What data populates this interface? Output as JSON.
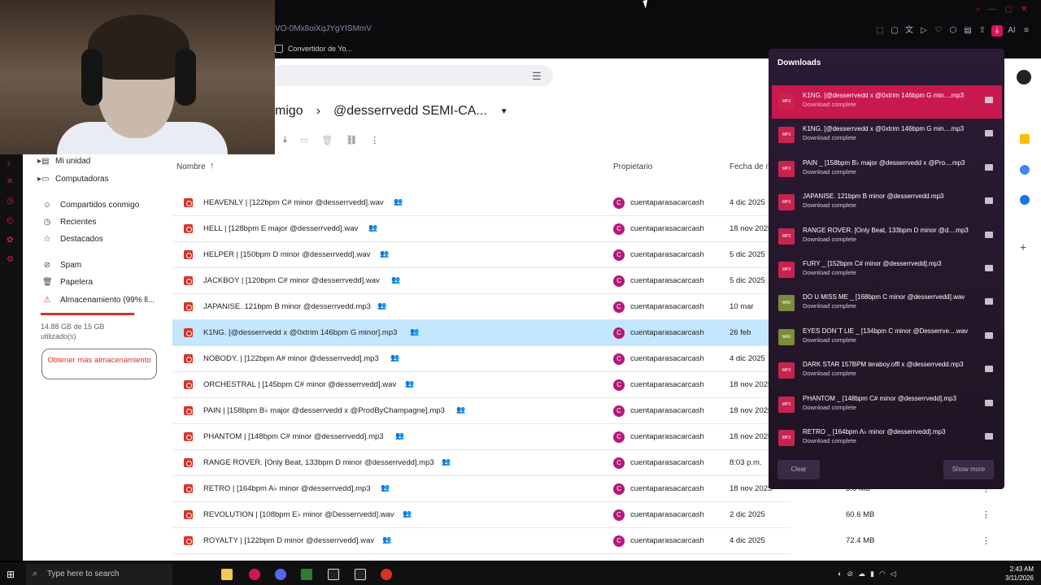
{
  "browser": {
    "url_fragment": "VO-0Mx8oiXqJYgYISMmV",
    "tab_label": "Convertidor de Yo...",
    "toolbar_ai_label": "AI"
  },
  "drive": {
    "breadcrumb_parent": "migo",
    "breadcrumb_current": "@desserrvedd SEMI-CA...",
    "sidebar": [
      {
        "icon": "drive-icon",
        "label": "Mi unidad"
      },
      {
        "icon": "computer-icon",
        "label": "Computadoras"
      },
      {
        "icon": "people-icon",
        "label": "Compartidos conmigo"
      },
      {
        "icon": "clock-icon",
        "label": "Recientes"
      },
      {
        "icon": "star-icon",
        "label": "Destacados"
      },
      {
        "icon": "spam-icon",
        "label": "Spam"
      },
      {
        "icon": "trash-icon",
        "label": "Papelera"
      },
      {
        "icon": "warning-icon",
        "label": "Almacenamiento (99% ll..."
      }
    ],
    "storage_fraction": 0.99,
    "storage_text": "14.88 GB de 15 GB utilizado(s)",
    "get_more_label": "Obtener más almacenamiento",
    "columns": {
      "name": "Nombre",
      "owner": "Propietario",
      "date": "Fecha de m"
    },
    "rows": [
      {
        "name": "HEAVENLY | [122bpm C# minor @desserrvedd].wav",
        "owner": "cuentaparasacarcash",
        "date": "4 dic 2025",
        "size": "",
        "selected": false
      },
      {
        "name": "HELL | [128bpm E major @desserrvedd].wav",
        "owner": "cuentaparasacarcash",
        "date": "18 nov 2025",
        "size": "",
        "selected": false
      },
      {
        "name": "HELPER | [150bpm D minor @desserrvedd].wav",
        "owner": "cuentaparasacarcash",
        "date": "5 dic 2025",
        "size": "",
        "selected": false
      },
      {
        "name": "JACKBOY | [120bpm C# minor @desserrvedd].wav",
        "owner": "cuentaparasacarcash",
        "date": "5 dic 2025",
        "size": "",
        "selected": false
      },
      {
        "name": "JAPANISE. 121bpm B minor @desserrvedd.mp3",
        "owner": "cuentaparasacarcash",
        "date": "10 mar",
        "size": "",
        "selected": false
      },
      {
        "name": "K1NG. [@desserrvedd x @0xtrim 146bpm G minor].mp3",
        "owner": "cuentaparasacarcash",
        "date": "26 feb",
        "size": "",
        "selected": true
      },
      {
        "name": "NOBODY. | [122bpm A# minor @desserrvedd].mp3",
        "owner": "cuentaparasacarcash",
        "date": "4 dic 2025",
        "size": "",
        "selected": false
      },
      {
        "name": "ORCHESTRAL | [145bpm C# minor @desserrvedd].wav",
        "owner": "cuentaparasacarcash",
        "date": "18 nov 2025",
        "size": "",
        "selected": false
      },
      {
        "name": "PAIN | [158bpm B♭ major @desserrvedd x @ProdByChampagne].mp3",
        "owner": "cuentaparasacarcash",
        "date": "18 nov 2025",
        "size": "",
        "selected": false
      },
      {
        "name": "PHANTOM | [148bpm C# minor @desserrvedd].mp3",
        "owner": "cuentaparasacarcash",
        "date": "18 nov 2025",
        "size": "",
        "selected": false
      },
      {
        "name": "RANGE ROVER. [Only Beat, 133bpm D minor @desserrvedd].mp3",
        "owner": "cuentaparasacarcash",
        "date": "8:03 p.m.",
        "size": "",
        "selected": false
      },
      {
        "name": "RETRO | [164bpm A♭ minor @desserrvedd].mp3",
        "owner": "cuentaparasacarcash",
        "date": "18 nov 2025",
        "size": "3.8 MB",
        "selected": false
      },
      {
        "name": "REVOLUTION | [108bpm E♭ minor @Desserrvedd].wav",
        "owner": "cuentaparasacarcash",
        "date": "2 dic 2025",
        "size": "60.6 MB",
        "selected": false
      },
      {
        "name": "ROYALTY | [122bpm D minor @desserrvedd].wav",
        "owner": "cuentaparasacarcash",
        "date": "4 dic 2025",
        "size": "72.4 MB",
        "selected": false
      }
    ]
  },
  "downloads": {
    "title": "Downloads",
    "items": [
      {
        "name": "K1NG. [@desserrvedd x @0xtrim 146bpm G min....mp3",
        "status": "Download complete",
        "type": "MP3",
        "active": true
      },
      {
        "name": "K1NG. [@desserrvedd x @0xtrim 146bpm G min....mp3",
        "status": "Download complete",
        "type": "MP3",
        "active": false
      },
      {
        "name": "PAIN _ [158bpm B♭ major @desserrvedd x @Pro....mp3",
        "status": "Download complete",
        "type": "MP3",
        "active": false
      },
      {
        "name": "JAPANISE. 121bpm B minor @desserrvedd.mp3",
        "status": "Download complete",
        "type": "MP3",
        "active": false
      },
      {
        "name": "RANGE ROVER. [Only Beat, 133bpm D minor @d....mp3",
        "status": "Download complete",
        "type": "MP3",
        "active": false
      },
      {
        "name": "FURY _ [152bpm C# minor @desserrvedd].mp3",
        "status": "Download complete",
        "type": "MP3",
        "active": false
      },
      {
        "name": "DO U MISS ME _ [168bpm C minor @desserrvedd].wav",
        "status": "Download complete",
        "type": "WAV",
        "active": false
      },
      {
        "name": "EYES DON´T LIE _ [134bpm C minor @Desserrve....wav",
        "status": "Download complete",
        "type": "WAV",
        "active": false
      },
      {
        "name": "DARK STAR 157BPM teraboy.offl x @desserrvedd.mp3",
        "status": "Download complete",
        "type": "MP3",
        "active": false
      },
      {
        "name": "PHANTOM _ [148bpm C# minor @desserrvedd].mp3",
        "status": "Download complete",
        "type": "MP3",
        "active": false
      },
      {
        "name": "RETRO _ [164bpm A♭ minor @desserrvedd].mp3",
        "status": "Download complete",
        "type": "MP3",
        "active": false
      }
    ],
    "clear_label": "Clear",
    "show_more_label": "Show more"
  },
  "taskbar": {
    "search_placeholder": "Type here to search",
    "time": "2:43 AM",
    "date": "3/11/2026"
  },
  "colors": {
    "accent_red": "#d93025",
    "selected_row": "#c2e7ff",
    "download_active": "#c8184e",
    "panel_bg": "#2b1b35"
  }
}
